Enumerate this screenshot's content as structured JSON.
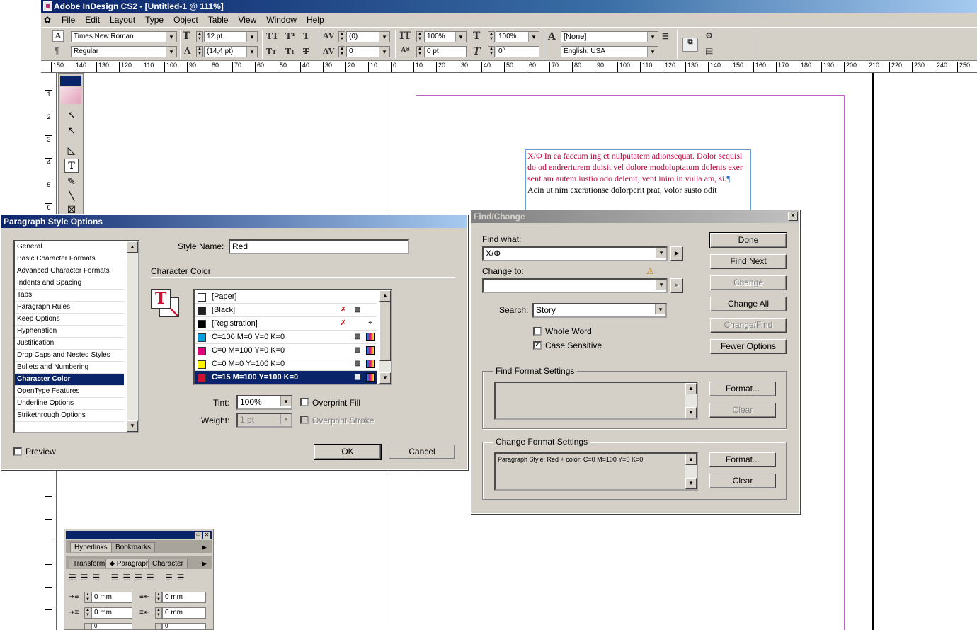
{
  "app": {
    "title": "Adobe InDesign CS2 - [Untitled-1 @ 111%]"
  },
  "menu": [
    "File",
    "Edit",
    "Layout",
    "Type",
    "Object",
    "Table",
    "View",
    "Window",
    "Help"
  ],
  "control": {
    "font_family": "Times New Roman",
    "font_style": "Regular",
    "font_size": "12 pt",
    "leading": "(14,4 pt)",
    "kerning": "(0)",
    "tracking": "0",
    "vscale": "100%",
    "baseline": "0 pt",
    "hscale": "100%",
    "skew": "0°",
    "char_style": "[None]",
    "language": "English: USA"
  },
  "ruler": {
    "h": [
      "150",
      "140",
      "130",
      "120",
      "110",
      "100",
      "90",
      "80",
      "70",
      "60",
      "50",
      "40",
      "30",
      "20",
      "10",
      "0",
      "10",
      "20",
      "30",
      "40",
      "50",
      "60",
      "70",
      "80",
      "90",
      "100",
      "110",
      "120",
      "130",
      "140",
      "150",
      "160",
      "170",
      "180",
      "190",
      "200",
      "210",
      "220",
      "230",
      "240",
      "250"
    ],
    "v": [
      "1",
      "2",
      "3",
      "4",
      "5",
      "6"
    ]
  },
  "doc_text": {
    "red": "X/Φ In ea faccum ing et nulputatem adionsequat. Dolor sequisl do od endreriurem duisit vel dolore modoluptatum dolenis exer sent am autem iustio odo delenit, vent inim in vulla am, si.",
    "pilcrow": "¶",
    "black": "Acin ut nim exerationse dolorperit prat, volor susto odit"
  },
  "pso": {
    "title": "Paragraph Style Options",
    "categories": [
      "General",
      "Basic Character Formats",
      "Advanced Character Formats",
      "Indents and Spacing",
      "Tabs",
      "Paragraph Rules",
      "Keep Options",
      "Hyphenation",
      "Justification",
      "Drop Caps and Nested Styles",
      "Bullets and Numbering",
      "Character Color",
      "OpenType Features",
      "Underline Options",
      "Strikethrough Options"
    ],
    "selected_category": "Character Color",
    "style_name_label": "Style Name:",
    "style_name": "Red",
    "section": "Character Color",
    "swatches": [
      {
        "name": "[Paper]",
        "color": "#ffffff"
      },
      {
        "name": "[Black]",
        "color": "#231f20"
      },
      {
        "name": "[Registration]",
        "color": "#000000"
      },
      {
        "name": "C=100 M=0 Y=0 K=0",
        "color": "#00a0e0"
      },
      {
        "name": "C=0 M=100 Y=0 K=0",
        "color": "#e0007a"
      },
      {
        "name": "C=0 M=0 Y=100 K=0",
        "color": "#fff200"
      },
      {
        "name": "C=15 M=100 Y=100 K=0",
        "color": "#d0102e"
      }
    ],
    "tint_label": "Tint:",
    "tint": "100%",
    "weight_label": "Weight:",
    "weight": "1 pt",
    "overprint_fill": "Overprint Fill",
    "overprint_stroke": "Overprint Stroke",
    "preview": "Preview",
    "ok": "OK",
    "cancel": "Cancel"
  },
  "fc": {
    "title": "Find/Change",
    "find_label": "Find what:",
    "find_value": "X/Φ",
    "change_label": "Change to:",
    "change_value": "",
    "search_label": "Search:",
    "search_value": "Story",
    "whole_word": "Whole Word",
    "case_sensitive": "Case Sensitive",
    "buttons": {
      "done": "Done",
      "find_next": "Find Next",
      "change": "Change",
      "change_all": "Change All",
      "change_find": "Change/Find",
      "fewer": "Fewer Options"
    },
    "find_format_title": "Find Format Settings",
    "find_format_text": "",
    "change_format_title": "Change Format Settings",
    "change_format_text": "Paragraph Style: Red + color: C=0 M=100 Y=0 K=0",
    "format": "Format...",
    "clear": "Clear"
  },
  "panels": {
    "top_tabs": [
      "Hyperlinks",
      "Bookmarks"
    ],
    "bottom_tabs": [
      "Transform",
      "Paragraph",
      "Character"
    ],
    "indent_left": "0 mm",
    "indent_right": "0 mm",
    "first_line": "0 mm",
    "last_line": "0 mm",
    "space_before": "0",
    "space_after": "0"
  },
  "colors": {
    "accent": "#0a246a",
    "red_text": "#c0003c",
    "margin_guide": "#c060c0",
    "frame": "#6aa0d8"
  }
}
